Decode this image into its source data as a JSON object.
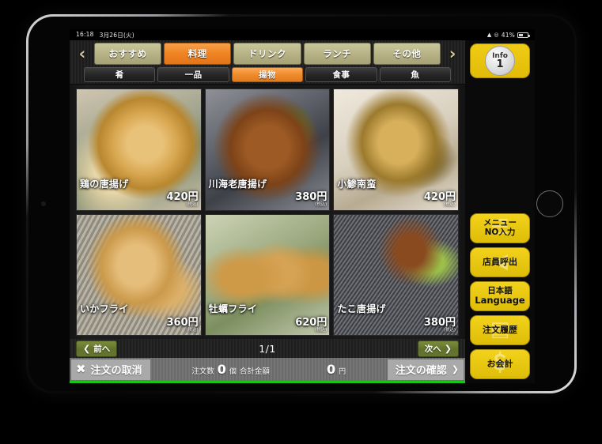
{
  "status_bar": {
    "time": "16:18",
    "date": "3月26日(火)",
    "wifi_icon": "wifi-icon",
    "location_icon": "location-icon",
    "battery_percent": "41%",
    "battery_level": 41
  },
  "nav": {
    "prev_arrow": "‹",
    "next_arrow": "›",
    "main_tabs": [
      {
        "label": "おすすめ",
        "active": false
      },
      {
        "label": "料理",
        "active": true
      },
      {
        "label": "ドリンク",
        "active": false
      },
      {
        "label": "ランチ",
        "active": false
      },
      {
        "label": "その他",
        "active": false
      }
    ],
    "sub_tabs": [
      {
        "label": "肴",
        "active": false
      },
      {
        "label": "一品",
        "active": false
      },
      {
        "label": "揚物",
        "active": true
      },
      {
        "label": "食事",
        "active": false
      },
      {
        "label": "魚",
        "active": false
      }
    ]
  },
  "menu_items": [
    {
      "name": "鶏の唐揚げ",
      "price": "420円",
      "tax_note": "(税込)",
      "photo": "ph1"
    },
    {
      "name": "川海老唐揚げ",
      "price": "380円",
      "tax_note": "(税込)",
      "photo": "ph2"
    },
    {
      "name": "小鯵南蛮",
      "price": "420円",
      "tax_note": "(税込)",
      "photo": "ph3"
    },
    {
      "name": "いかフライ",
      "price": "360円",
      "tax_note": "(税込)",
      "photo": "ph4"
    },
    {
      "name": "牡蠣フライ",
      "price": "620円",
      "tax_note": "(税込)",
      "photo": "ph5"
    },
    {
      "name": "たこ唐揚げ",
      "price": "380円",
      "tax_note": "(税込)",
      "photo": "ph6"
    }
  ],
  "pager": {
    "prev_label": "前へ",
    "prev_chevron": "❮",
    "page_indicator": "1/1",
    "next_label": "次へ",
    "next_chevron": "❯"
  },
  "order_bar": {
    "cancel_label": "注文の取消",
    "cancel_icon": "✖",
    "count_label": "注文数",
    "count_value": "0",
    "count_unit": "個",
    "total_label": "合計金額",
    "total_value": "0",
    "total_unit": "円",
    "confirm_label": "注文の確認",
    "confirm_chevron": "❯"
  },
  "side_rail": {
    "info_word": "Info",
    "info_count": "1",
    "buttons": [
      {
        "line1": "メニュー",
        "line2": "NO入力",
        "glyph": "☰",
        "icon": "menu-number-icon"
      },
      {
        "line1": "店員呼出",
        "line2": "",
        "glyph": "◀",
        "icon": "call-staff-icon"
      },
      {
        "line1": "日本語",
        "line2": "Language",
        "glyph": "",
        "icon": "language-icon"
      },
      {
        "line1": "注文履歴",
        "line2": "",
        "glyph": "▤",
        "icon": "order-history-icon"
      },
      {
        "line1": "お会計",
        "line2": "",
        "glyph": "＄",
        "icon": "checkout-icon"
      }
    ]
  },
  "colors": {
    "accent_orange": "#f08423",
    "rail_yellow": "#ecc70f",
    "pager_green": "#66752e",
    "status_green": "#17c617",
    "tab_khaki": "#b5b184"
  }
}
